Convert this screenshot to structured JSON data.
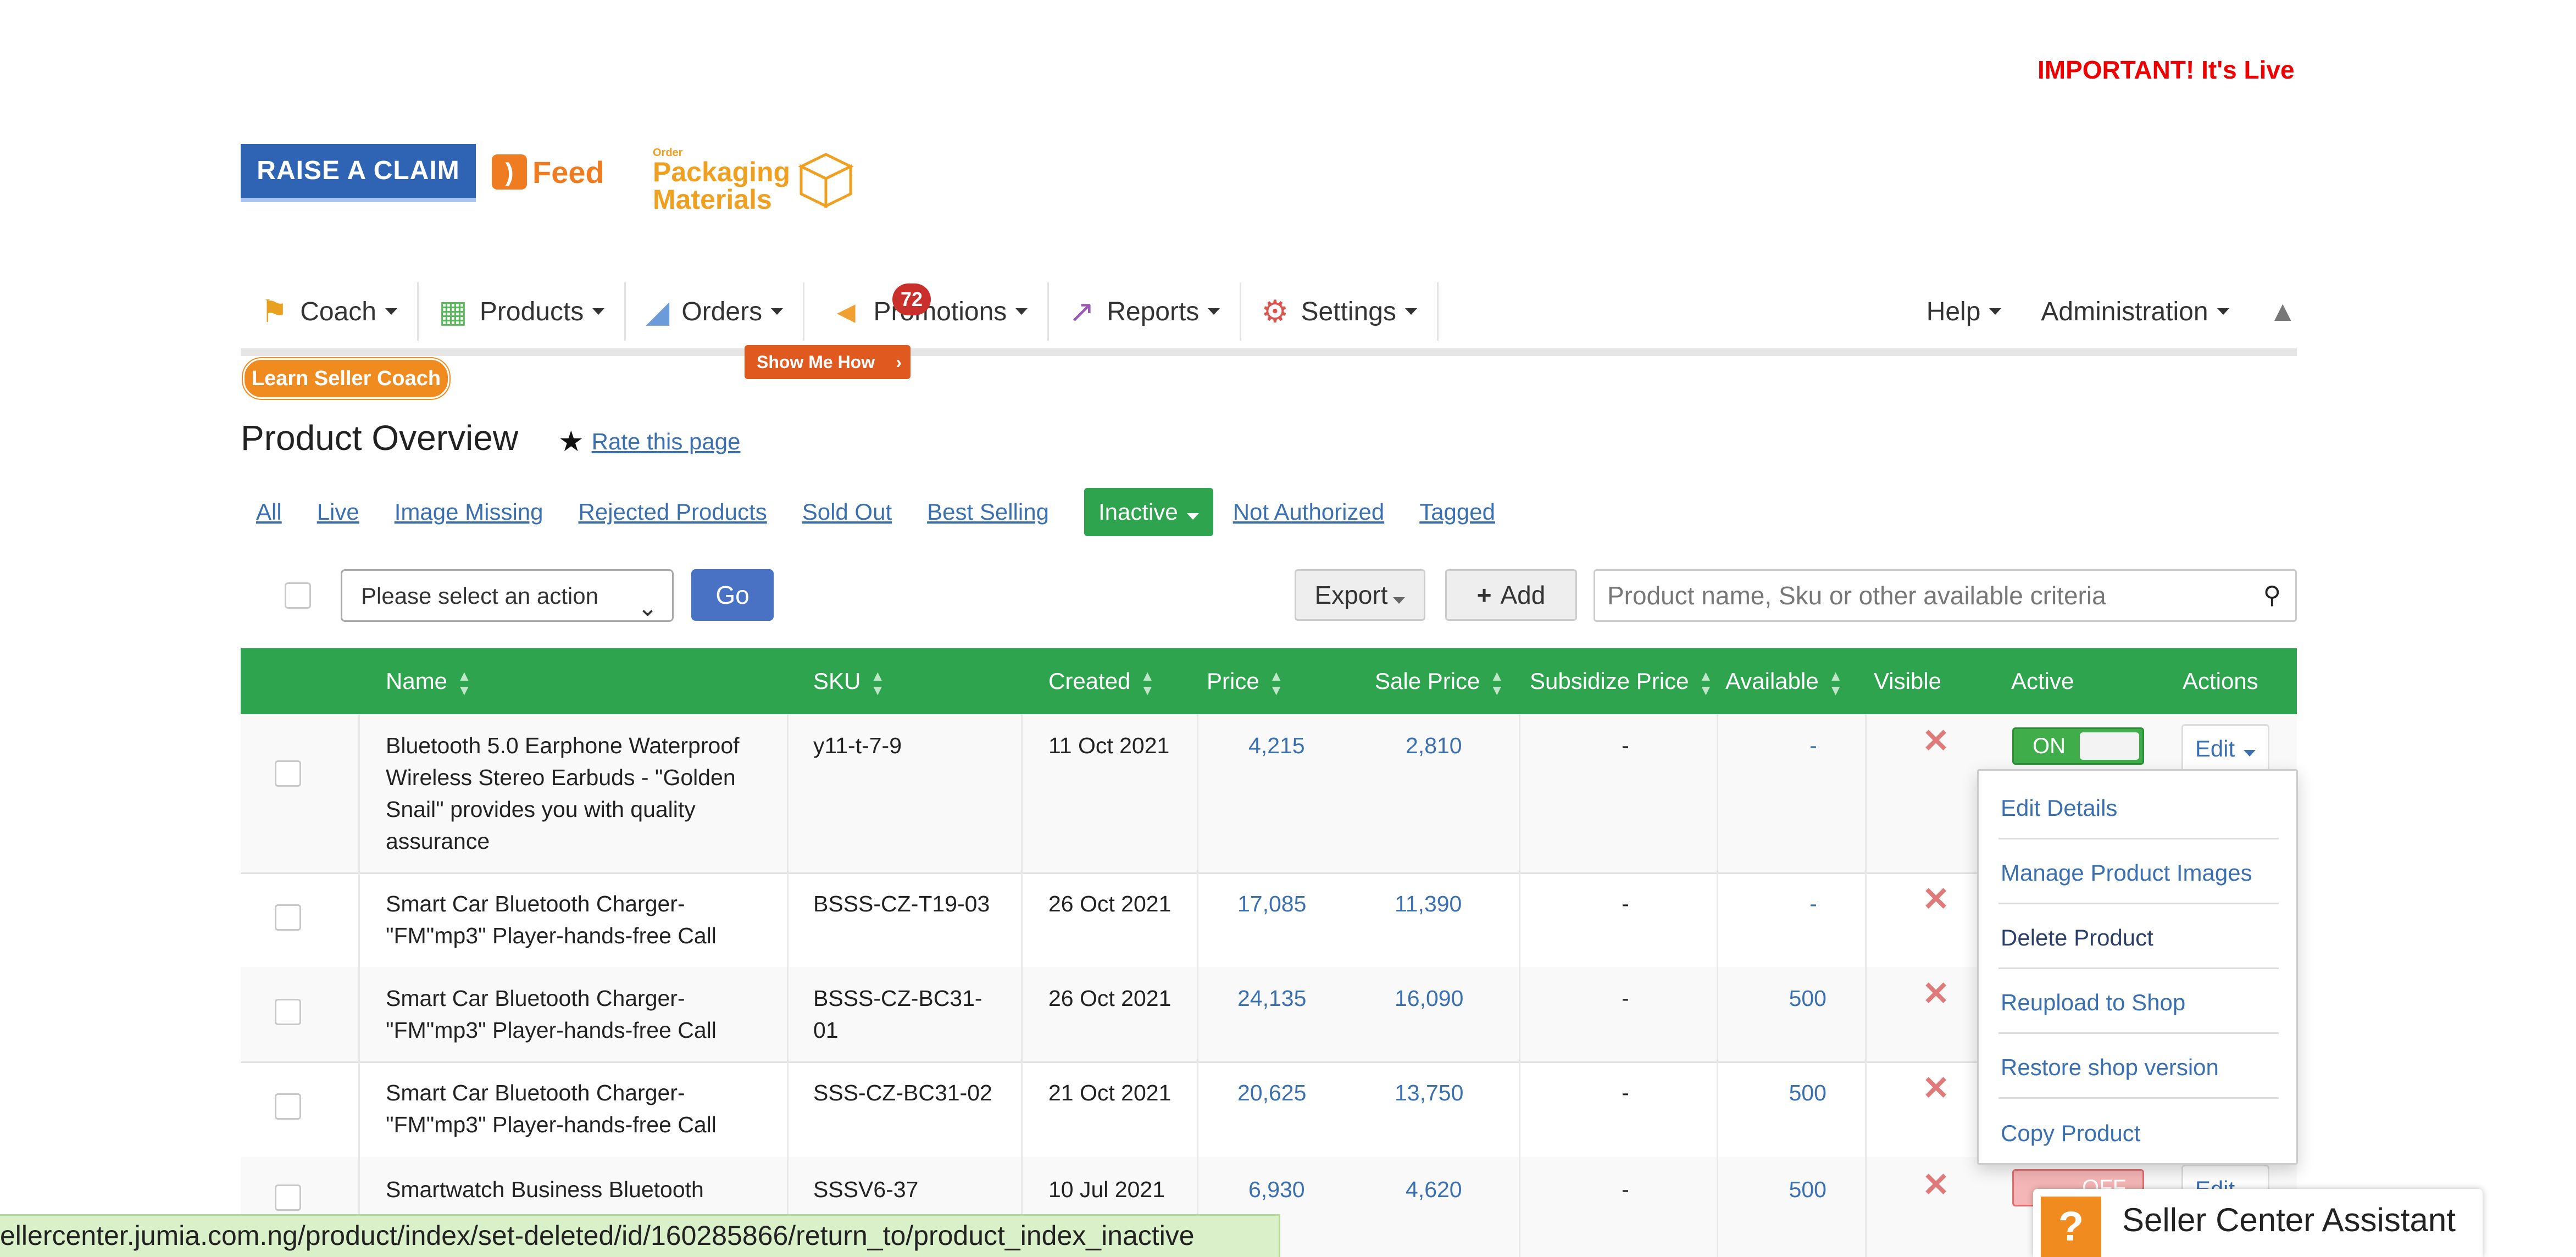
{
  "notice": "IMPORTANT! It's Live",
  "banners": {
    "raise_claim": "RAISE A CLAIM",
    "feed": "Feed",
    "packaging_small": "Order",
    "packaging_line1": "Packaging",
    "packaging_line2": "Materials"
  },
  "nav": {
    "items": [
      {
        "label": "Coach",
        "icon": "coach-icon"
      },
      {
        "label": "Products",
        "icon": "grid-icon"
      },
      {
        "label": "Orders",
        "icon": "tag-icon"
      },
      {
        "label": "Promotions",
        "icon": "megaphone-icon"
      },
      {
        "label": "Reports",
        "icon": "chart-icon"
      },
      {
        "label": "Settings",
        "icon": "gear-icon"
      }
    ],
    "right": [
      {
        "label": "Help"
      },
      {
        "label": "Administration"
      }
    ],
    "orders_badge": "72",
    "show_me_how": "Show Me How",
    "learn_coach": "Learn Seller Coach"
  },
  "page": {
    "title": "Product Overview",
    "rate_link": "Rate this page"
  },
  "filters": [
    "All",
    "Live",
    "Image Missing",
    "Rejected Products",
    "Sold Out",
    "Best Selling",
    "Inactive",
    "Not Authorized",
    "Tagged"
  ],
  "toolbar": {
    "action_select": "Please select an action",
    "go": "Go",
    "export": "Export",
    "add": "Add",
    "search_placeholder": "Product name, Sku or other available criteria"
  },
  "table": {
    "headers": [
      "Name",
      "SKU",
      "Created",
      "Price",
      "Sale Price",
      "Subsidize Price",
      "Available",
      "Visible",
      "Active",
      "Actions"
    ],
    "rows": [
      {
        "name": [
          "Bluetooth 5.0 Earphone Waterproof",
          "Wireless Stereo Earbuds - \"Golden",
          "Snail\" provides you with quality",
          "assurance"
        ],
        "sku": [
          "y11-t-7-9"
        ],
        "created": "11 Oct 2021",
        "price": "4,215",
        "sale": "2,810",
        "subsidize": "-",
        "available": "-",
        "active": "ON",
        "action": "Edit"
      },
      {
        "name": [
          "Smart Car Bluetooth Charger-",
          "\"FM\"mp3\" Player-hands-free Call"
        ],
        "sku": [
          "BSSS-CZ-T19-03"
        ],
        "created": "26 Oct 2021",
        "price": "17,085",
        "sale": "11,390",
        "subsidize": "-",
        "available": "-"
      },
      {
        "name": [
          "Smart Car Bluetooth Charger-",
          "\"FM\"mp3\" Player-hands-free Call"
        ],
        "sku": [
          "BSSS-CZ-BC31-",
          "01"
        ],
        "created": "26 Oct 2021",
        "price": "24,135",
        "sale": "16,090",
        "subsidize": "-",
        "available": "500"
      },
      {
        "name": [
          "Smart Car Bluetooth Charger-",
          "\"FM\"mp3\" Player-hands-free Call"
        ],
        "sku": [
          "SSS-CZ-BC31-02"
        ],
        "created": "21 Oct 2021",
        "price": "20,625",
        "sale": "13,750",
        "subsidize": "-",
        "available": "500"
      },
      {
        "name": [
          "Smartwatch Business Bluetooth"
        ],
        "sku": [
          "SSSV6-37"
        ],
        "created": "10 Jul 2021",
        "price": "6,930",
        "sale": "4,620",
        "subsidize": "-",
        "available": "500",
        "active": "OFF",
        "action": "Edit"
      }
    ]
  },
  "edit_menu": [
    "Edit Details",
    "Manage Product Images",
    "Delete Product",
    "Reupload to Shop",
    "Restore shop version",
    "Copy Product"
  ],
  "status_url": "ellercenter.jumia.com.ng/product/index/set-deleted/id/160285866/return_to/product_index_inactive",
  "assistant": {
    "icon": "?",
    "label": "Seller Center Assistant"
  },
  "colors": {
    "accent_green": "#2ea44f",
    "link_blue": "#3a6fb0",
    "orange": "#f08b20",
    "alert_red": "#e00000"
  }
}
